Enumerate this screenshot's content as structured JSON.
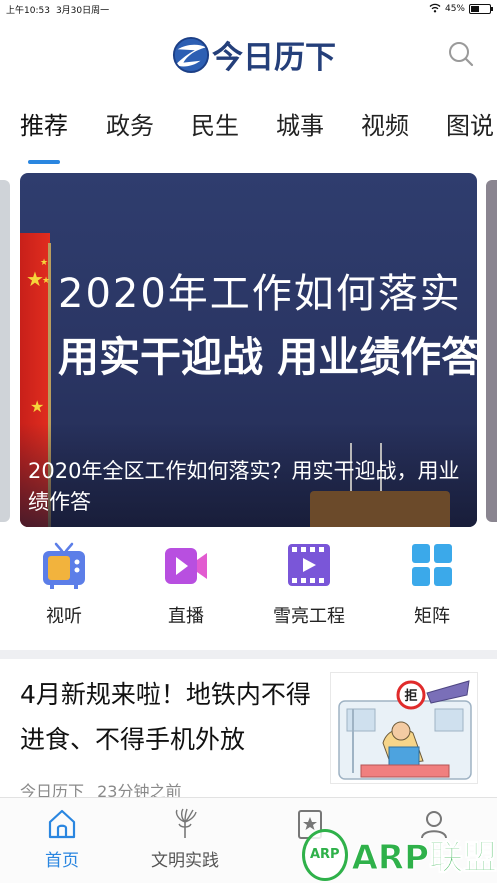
{
  "status_bar": {
    "time": "上午10:53",
    "date": "3月30日周一",
    "battery": "45%",
    "battery_level": 0.45
  },
  "header": {
    "app_name": "今日历下",
    "search_icon": "search-icon",
    "brand_color": "#243f7a"
  },
  "tabs": [
    {
      "label": "推荐",
      "active": true
    },
    {
      "label": "政务",
      "active": false
    },
    {
      "label": "民生",
      "active": false
    },
    {
      "label": "城事",
      "active": false
    },
    {
      "label": "视频",
      "active": false
    },
    {
      "label": "图说",
      "active": false
    }
  ],
  "accent_color": "#2a86e0",
  "banner": {
    "headline_line1": "2020年工作如何落实",
    "headline_line2": "用实干迎战  用业绩作答",
    "caption": "2020年全区工作如何落实？用实干迎战，用业绩作答"
  },
  "quick_menu": [
    {
      "label": "视听",
      "icon": "tv-icon"
    },
    {
      "label": "直播",
      "icon": "video-camera-icon"
    },
    {
      "label": "雪亮工程",
      "icon": "film-play-icon"
    },
    {
      "label": "矩阵",
      "icon": "grid-icon"
    }
  ],
  "news": {
    "title": "4月新规来啦！地铁内不得进食、不得手机外放",
    "source": "今日历下",
    "time": "23分钟之前",
    "thumb_sign": "拒"
  },
  "bottom_nav": [
    {
      "label": "首页",
      "icon": "home-icon",
      "active": true
    },
    {
      "label": "文明实践",
      "icon": "torch-icon",
      "active": false
    },
    {
      "label": "",
      "icon": "star-bookmark-icon",
      "active": false
    },
    {
      "label": "",
      "icon": "user-icon",
      "active": false
    }
  ],
  "watermark": {
    "circle_text": "ARP",
    "text": "ARP联盟"
  }
}
